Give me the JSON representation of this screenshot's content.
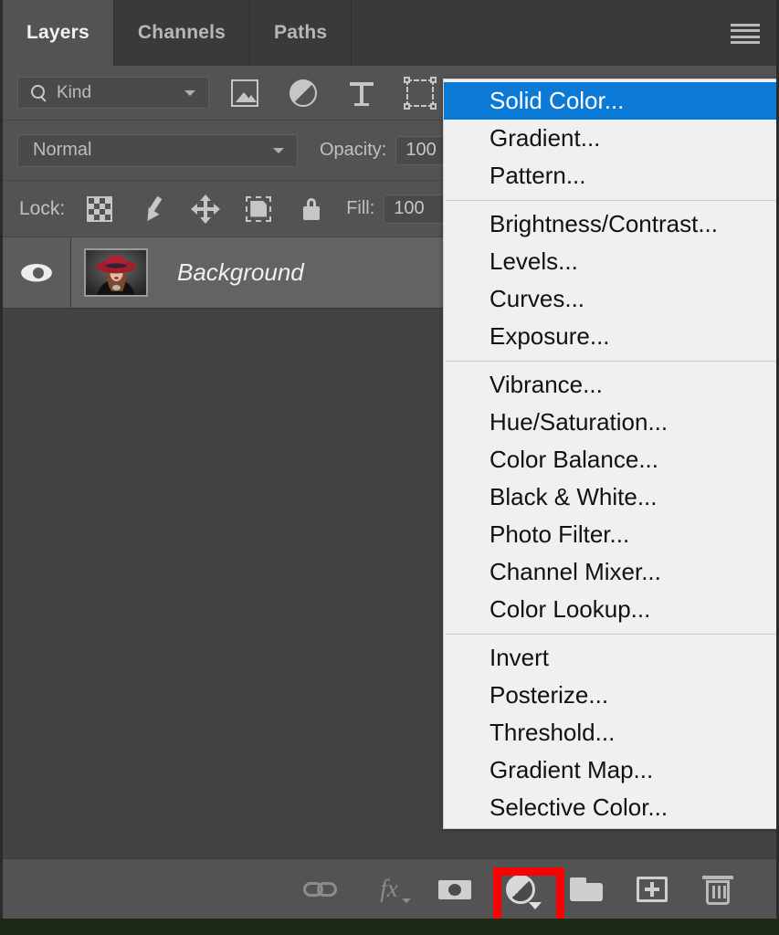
{
  "panel": {
    "tabs": [
      {
        "label": "Layers",
        "active": true
      },
      {
        "label": "Channels",
        "active": false
      },
      {
        "label": "Paths",
        "active": false
      }
    ],
    "menu_icon": "hamburger-icon"
  },
  "filter_row": {
    "search_icon": "search-icon",
    "kind_value": "Kind",
    "kind_placeholder": "Kind",
    "dropdown_icon": "chevron-down-icon",
    "filter_icons": [
      "pixel-layer-filter-icon",
      "adjustment-layer-filter-icon",
      "type-layer-filter-icon",
      "shape-layer-filter-icon"
    ]
  },
  "blend_row": {
    "blend_mode": "Normal",
    "blend_placeholder": "Normal",
    "dropdown_icon": "chevron-down-icon",
    "opacity_label": "Opacity:",
    "opacity_value": "100"
  },
  "lock_row": {
    "lock_label": "Lock:",
    "lock_icons": [
      "lock-transparent-pixels-icon",
      "lock-image-pixels-icon",
      "lock-position-icon",
      "lock-artboard-nesting-icon",
      "lock-all-icon"
    ],
    "fill_label": "Fill:",
    "fill_value": "100"
  },
  "layers": [
    {
      "name": "Background",
      "visible": true,
      "visibility_icon": "eye-icon",
      "thumbnail": "woman-in-red-hat-photo"
    }
  ],
  "bottom_toolbar": {
    "buttons": [
      {
        "name": "link-layers-button",
        "icon": "chain-link-icon",
        "label": "Link layers"
      },
      {
        "name": "layer-style-button",
        "icon": "fx-icon",
        "label": "fx"
      },
      {
        "name": "add-layer-mask-button",
        "icon": "mask-icon",
        "label": "Add layer mask"
      },
      {
        "name": "new-adjustment-layer-button",
        "icon": "half-circle-adjustment-icon",
        "label": "Create new fill or adjustment layer"
      },
      {
        "name": "new-group-button",
        "icon": "folder-icon",
        "label": "Create a new group"
      },
      {
        "name": "new-layer-button",
        "icon": "plus-square-icon",
        "label": "Create a new layer"
      },
      {
        "name": "delete-layer-button",
        "icon": "trash-icon",
        "label": "Delete layer"
      }
    ],
    "fx_label": "fx",
    "highlight_color": "#fb0101",
    "highlighted_button": "new-adjustment-layer-button"
  },
  "context_menu": {
    "selected_item": "Solid Color...",
    "highlight_color": "#0a7ad6",
    "groups": [
      {
        "items": [
          {
            "label": "Solid Color...",
            "selected": true
          },
          {
            "label": "Gradient...",
            "selected": false
          },
          {
            "label": "Pattern...",
            "selected": false
          }
        ]
      },
      {
        "items": [
          {
            "label": "Brightness/Contrast...",
            "selected": false
          },
          {
            "label": "Levels...",
            "selected": false
          },
          {
            "label": "Curves...",
            "selected": false
          },
          {
            "label": "Exposure...",
            "selected": false
          }
        ]
      },
      {
        "items": [
          {
            "label": "Vibrance...",
            "selected": false
          },
          {
            "label": "Hue/Saturation...",
            "selected": false
          },
          {
            "label": "Color Balance...",
            "selected": false
          },
          {
            "label": "Black & White...",
            "selected": false
          },
          {
            "label": "Photo Filter...",
            "selected": false
          },
          {
            "label": "Channel Mixer...",
            "selected": false
          },
          {
            "label": "Color Lookup...",
            "selected": false
          }
        ]
      },
      {
        "items": [
          {
            "label": "Invert",
            "selected": false
          },
          {
            "label": "Posterize...",
            "selected": false
          },
          {
            "label": "Threshold...",
            "selected": false
          },
          {
            "label": "Gradient Map...",
            "selected": false
          },
          {
            "label": "Selective Color...",
            "selected": false
          }
        ]
      }
    ]
  }
}
